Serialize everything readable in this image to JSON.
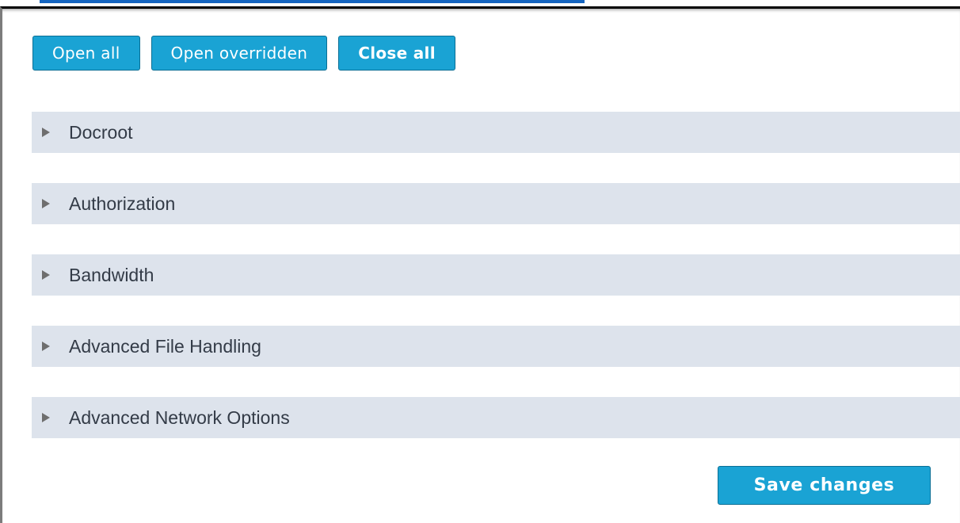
{
  "toolbar": {
    "open_all_label": "Open all",
    "open_overridden_label": "Open overridden",
    "close_all_label": "Close all"
  },
  "sections": [
    {
      "label": "Docroot"
    },
    {
      "label": "Authorization"
    },
    {
      "label": "Bandwidth"
    },
    {
      "label": "Advanced File Handling"
    },
    {
      "label": "Advanced Network Options"
    }
  ],
  "footer": {
    "save_label": "Save changes"
  },
  "colors": {
    "button_bg": "#1aa3d4",
    "section_bg": "#dde3ec",
    "tab_underline": "#1565c0"
  },
  "icons": {
    "section_toggle": "triangle-right-icon"
  }
}
